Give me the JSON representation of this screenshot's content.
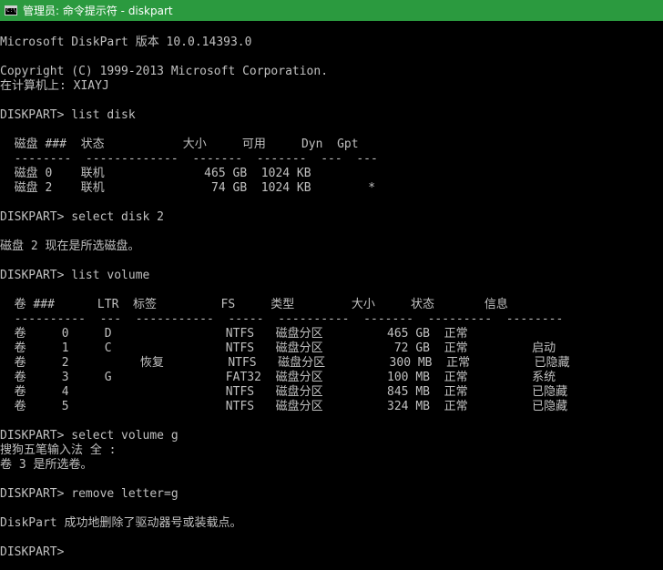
{
  "window": {
    "title": "管理员: 命令提示符 - diskpart",
    "icon": "cmd-icon"
  },
  "console": {
    "lines": [
      "Microsoft DiskPart 版本 10.0.14393.0",
      "Copyright (C) 1999-2013 Microsoft Corporation.",
      "在计算机上: XIAYJ",
      "DISKPART> list disk",
      "  磁盘 ###  状态           大小     可用     Dyn  Gpt",
      "  --------  -------------  -------  -------  ---  ---",
      "  磁盘 0    联机              465 GB  1024 KB",
      "  磁盘 2    联机               74 GB  1024 KB        *",
      "DISKPART> select disk 2",
      "磁盘 2 现在是所选磁盘。",
      "DISKPART> list volume",
      "  卷 ###      LTR  标签         FS     类型        大小     状态       信息",
      "  ----------  ---  -----------  -----  ----------  -------  ---------  --------",
      "  卷     0     D                NTFS   磁盘分区         465 GB  正常",
      "  卷     1     C                NTFS   磁盘分区          72 GB  正常         启动",
      "  卷     2          恢复         NTFS   磁盘分区         300 MB  正常         已隐藏",
      "  卷     3     G                FAT32  磁盘分区         100 MB  正常         系统",
      "  卷     4                      NTFS   磁盘分区         845 MB  正常         已隐藏",
      "  卷     5                      NTFS   磁盘分区         324 MB  正常         已隐藏",
      "DISKPART> select volume g",
      "搜狗五笔输入法 全 :",
      "卷 3 是所选卷。",
      "DISKPART> remove letter=g",
      "DiskPart 成功地删除了驱动器号或装载点。",
      "DISKPART>"
    ]
  },
  "colors": {
    "titlebar_bg": "#2b9a3f",
    "console_bg": "#000000",
    "console_text": "#c0c0c0"
  }
}
